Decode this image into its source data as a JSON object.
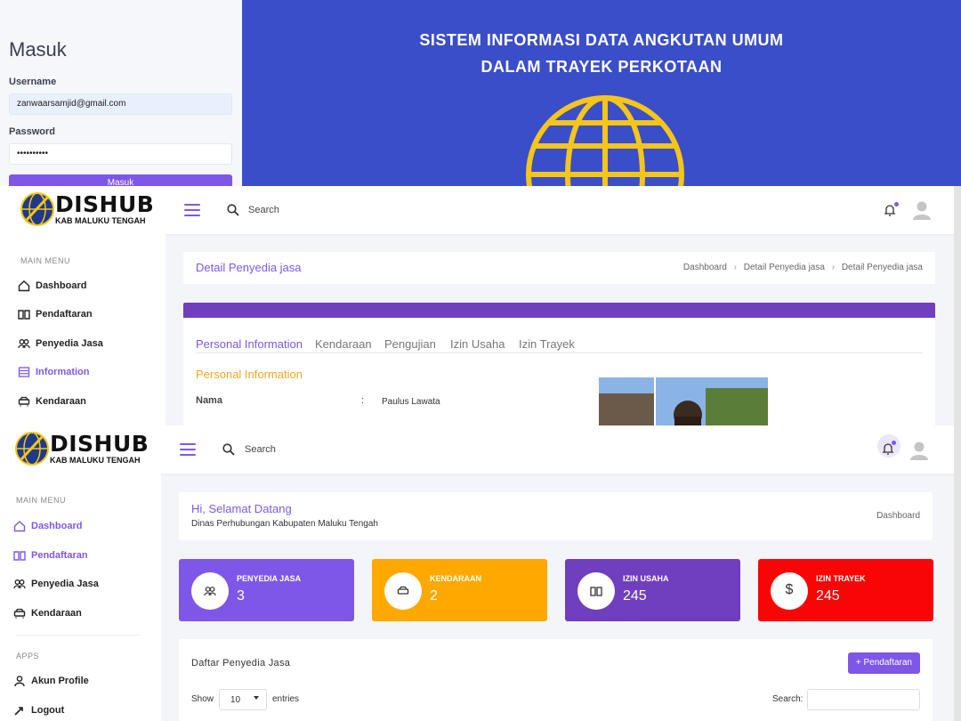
{
  "login": {
    "title": "Masuk",
    "username_label": "Username",
    "username_value": "zanwaarsamjid@gmail.com",
    "password_label": "Password",
    "password_value": "••••••••••",
    "submit_label": "Masuk",
    "banner_line1": "SISTEM INFORMASI DATA ANGKUTAN UMUM",
    "banner_line2": "DALAM TRAYEK PERKOTAAN"
  },
  "brand": {
    "name": "DISHUB",
    "sub": "KAB MALUKU TENGAH"
  },
  "header": {
    "search_label": "Search"
  },
  "detail": {
    "sidebar": {
      "heading": "MAIN MENU",
      "items": [
        "Dashboard",
        "Pendaftaran",
        "Penyedia Jasa",
        "Information",
        "Kendaraan"
      ]
    },
    "page_title": "Detail Penyedia jasa",
    "breadcrumb": [
      "Dashboard",
      "Detail Penyedia jasa",
      "Detail Penyedia jasa"
    ],
    "tabs": [
      "Personal Information",
      "Kendaraan",
      "Pengujian",
      "Izin Usaha",
      "Izin Trayek"
    ],
    "section_title": "Personal Information",
    "field_label": "Nama",
    "field_sep": ":",
    "field_value": "Paulus Lawata"
  },
  "dashboard": {
    "sidebar": {
      "heading": "MAIN MENU",
      "items": [
        "Dashboard",
        "Pendaftaran",
        "Penyedia Jasa",
        "Kendaraan"
      ],
      "apps_heading": "APPS",
      "apps_items": [
        "Akun Profile",
        "Logout"
      ]
    },
    "welcome": "Hi, Selamat Datang",
    "subtitle": "Dinas Perhubungan Kabupaten Maluku Tengah",
    "breadcrumb": "Dashboard",
    "stats": [
      {
        "label": "PENYEDIA JASA",
        "value": "3",
        "color": "#7e57e8"
      },
      {
        "label": "KENDARAAN",
        "value": "2",
        "color": "#ffa800"
      },
      {
        "label": "IZIN USAHA",
        "value": "245",
        "color": "#6f3fbf"
      },
      {
        "label": "IZIN TRAYEK",
        "value": "245",
        "color": "#fa0505"
      }
    ],
    "table_title": "Daftar Penyedia Jasa",
    "add_button": "+ Pendaftaran",
    "show_label": "Show",
    "entries_value": "10",
    "entries_label": "entries",
    "search_label": "Search:"
  },
  "colors": {
    "accent": "#7e57e8",
    "banner": "#3a4ec9",
    "title_orange": "#f5a623"
  }
}
